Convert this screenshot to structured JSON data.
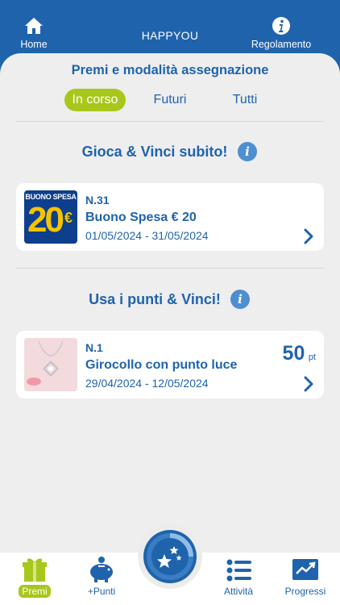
{
  "header": {
    "home_label": "Home",
    "title": "HAPPYOU",
    "rules_label": "Regolamento"
  },
  "panel": {
    "title": "Premi e modalità assegnazione",
    "tabs": [
      {
        "label": "In corso",
        "active": true
      },
      {
        "label": "Futuri",
        "active": false
      },
      {
        "label": "Tutti",
        "active": false
      }
    ]
  },
  "section1": {
    "title": "Gioca & Vinci subito!",
    "card": {
      "thumb_text_top": "BUONO SPESA",
      "thumb_text_value": "20",
      "thumb_text_currency": "€",
      "number": "N.31",
      "name": "Buono Spesa € 20",
      "dates": "01/05/2024 - 31/05/2024"
    }
  },
  "section2": {
    "title": "Usa i punti & Vinci!",
    "card": {
      "number": "N.1",
      "name": "Girocollo con punto luce",
      "dates": "29/04/2024 - 12/05/2024",
      "points": "50",
      "points_unit": "pt"
    }
  },
  "nav": {
    "items": [
      {
        "label": "Premi",
        "icon": "gift-icon",
        "active": true
      },
      {
        "label": "+Punti",
        "icon": "piggy-bank-icon",
        "active": false
      },
      {
        "label": "Attività",
        "icon": "list-icon",
        "active": false
      },
      {
        "label": "Progressi",
        "icon": "trend-chart-icon",
        "active": false
      }
    ],
    "fab_icon": "stars-progress-icon"
  },
  "colors": {
    "brand_blue": "#1f63ad",
    "accent_green": "#a8c71c",
    "info_blue": "#4d8fd1"
  }
}
